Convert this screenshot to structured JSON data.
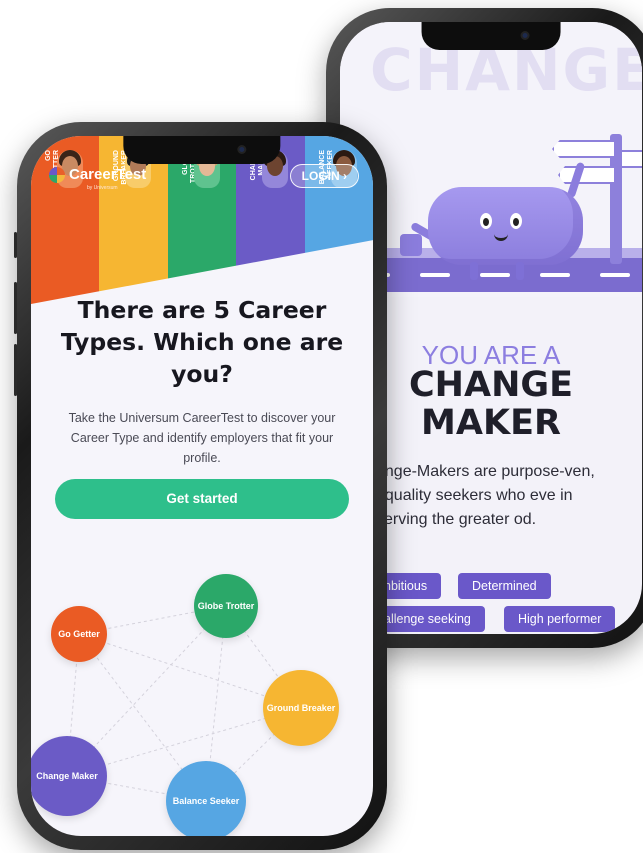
{
  "left_phone": {
    "logo_text": "CareerTest",
    "logo_sub": "by Universum",
    "login_label": "LOGIN",
    "login_icon": "chevron-right-icon",
    "stripes": [
      {
        "label": "GO GETTER",
        "color": "#ea5b24"
      },
      {
        "label": "GROUND BREAKER",
        "color": "#f6b632"
      },
      {
        "label": "GLOBE TROTTER",
        "color": "#2ba869"
      },
      {
        "label": "CHANGE MAKER",
        "color": "#6b5bc6"
      },
      {
        "label": "BALANCE SEEKER",
        "color": "#56a6e3"
      }
    ],
    "headline": "There are 5 Career Types. Which one are you?",
    "subtext": "Take the Universum CareerTest to discover your Career Type and identify employers that fit your profile.",
    "cta_label": "Get started",
    "nodes": [
      {
        "label": "Go Getter",
        "color": "#ea5b24"
      },
      {
        "label": "Globe Trotter",
        "color": "#2ba869"
      },
      {
        "label": "Ground Breaker",
        "color": "#f6b632"
      },
      {
        "label": "Change Maker",
        "color": "#6b5bc6"
      },
      {
        "label": "Balance Seeker",
        "color": "#56a6e3"
      }
    ]
  },
  "right_phone": {
    "you_are": "YOU ARE A",
    "type_line1": "CHANGE",
    "type_line2": "MAKER",
    "description": "ange-Makers are purpose-ven, equality seekers who eve in serving the greater od.",
    "traits": [
      "nbitious",
      "Determined",
      "allenge seeking",
      "High performer"
    ],
    "accent_color": "#6a58c9"
  }
}
